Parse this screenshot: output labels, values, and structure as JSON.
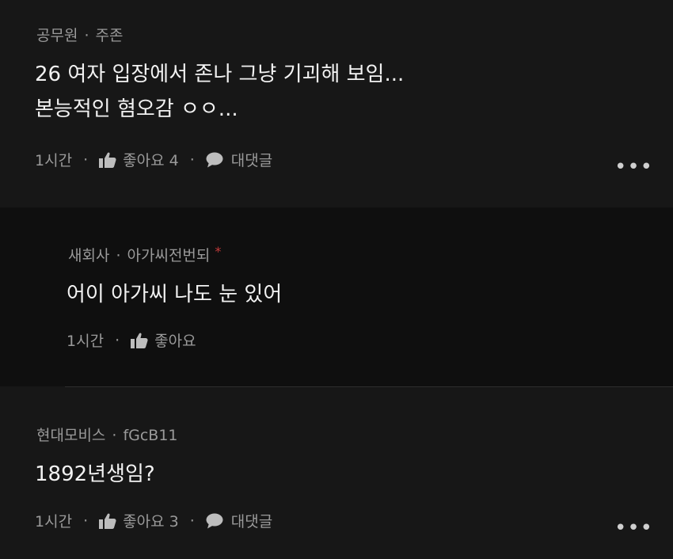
{
  "comments": [
    {
      "author": "공무원",
      "nickname": "주존",
      "lines": [
        "26 여자 입장에서 존나 그냥 기괴해 보임...",
        "본능적인 혐오감 ㅇㅇ..."
      ],
      "time": "1시간",
      "like_label": "좋아요 4",
      "reply_label": "대댓글",
      "more": "•••"
    },
    {
      "author": "새회사",
      "nickname": "아가씨전번되",
      "badge": "*",
      "lines": [
        "어이 아가씨 나도 눈 있어"
      ],
      "time": "1시간",
      "like_label": "좋아요"
    },
    {
      "author": "현대모비스",
      "nickname": "fGcB11",
      "lines": [
        "1892년생임?"
      ],
      "time": "1시간",
      "like_label": "좋아요 3",
      "reply_label": "대댓글",
      "more": "•••"
    }
  ],
  "separator": "·",
  "icons": {
    "like": "thumbs-up-icon",
    "reply": "speech-bubble-icon",
    "more": "more-options-icon"
  },
  "colors": {
    "background": "#171717",
    "reply_background": "#0f0f0f",
    "badge": "#c23b3b"
  }
}
